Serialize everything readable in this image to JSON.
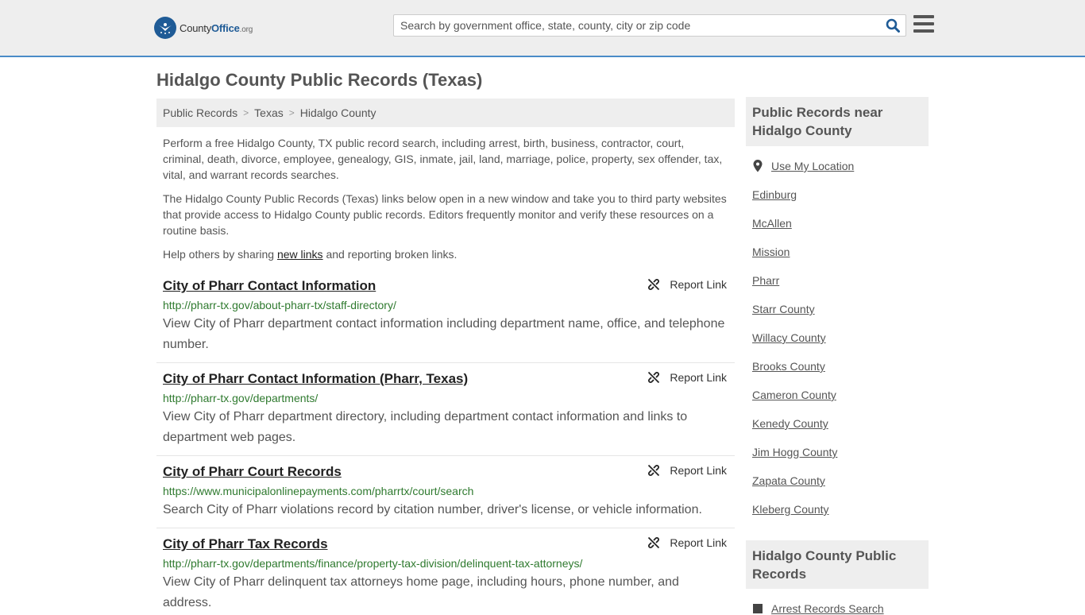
{
  "header": {
    "logo_main": "County",
    "logo_bold": "Office",
    "logo_org": ".org",
    "search_placeholder": "Search by government office, state, county, city or zip code"
  },
  "page": {
    "title": "Hidalgo County Public Records (Texas)"
  },
  "breadcrumb": [
    "Public Records",
    "Texas",
    "Hidalgo County"
  ],
  "intro": {
    "p1": "Perform a free Hidalgo County, TX public record search, including arrest, birth, business, contractor, court, criminal, death, divorce, employee, genealogy, GIS, inmate, jail, land, marriage, police, property, sex offender, tax, vital, and warrant records searches.",
    "p2": "The Hidalgo County Public Records (Texas) links below open in a new window and take you to third party websites that provide access to Hidalgo County public records. Editors frequently monitor and verify these resources on a routine basis.",
    "p3_before": "Help others by sharing ",
    "p3_link": "new links",
    "p3_after": " and reporting broken links."
  },
  "report_label": "Report Link",
  "records": [
    {
      "title": "City of Pharr Contact Information",
      "url": "http://pharr-tx.gov/about-pharr-tx/staff-directory/",
      "desc": "View City of Pharr department contact information including department name, office, and telephone number."
    },
    {
      "title": "City of Pharr Contact Information (Pharr, Texas)",
      "url": "http://pharr-tx.gov/departments/",
      "desc": "View City of Pharr department directory, including department contact information and links to department web pages."
    },
    {
      "title": "City of Pharr Court Records",
      "url": "https://www.municipalonlinepayments.com/pharrtx/court/search",
      "desc": "Search City of Pharr violations record by citation number, driver's license, or vehicle information."
    },
    {
      "title": "City of Pharr Tax Records",
      "url": "http://pharr-tx.gov/departments/finance/property-tax-division/delinquent-tax-attorneys/",
      "desc": "View City of Pharr delinquent tax attorneys home page, including hours, phone number, and address."
    }
  ],
  "sidebar": {
    "near_title": "Public Records near Hidalgo County",
    "use_location": "Use My Location",
    "near_links": [
      "Edinburg",
      "McAllen",
      "Mission",
      "Pharr",
      "Starr County",
      "Willacy County",
      "Brooks County",
      "Cameron County",
      "Kenedy County",
      "Jim Hogg County",
      "Zapata County",
      "Kleberg County"
    ],
    "county_title": "Hidalgo County Public Records",
    "county_first_link": "Arrest Records Search"
  }
}
